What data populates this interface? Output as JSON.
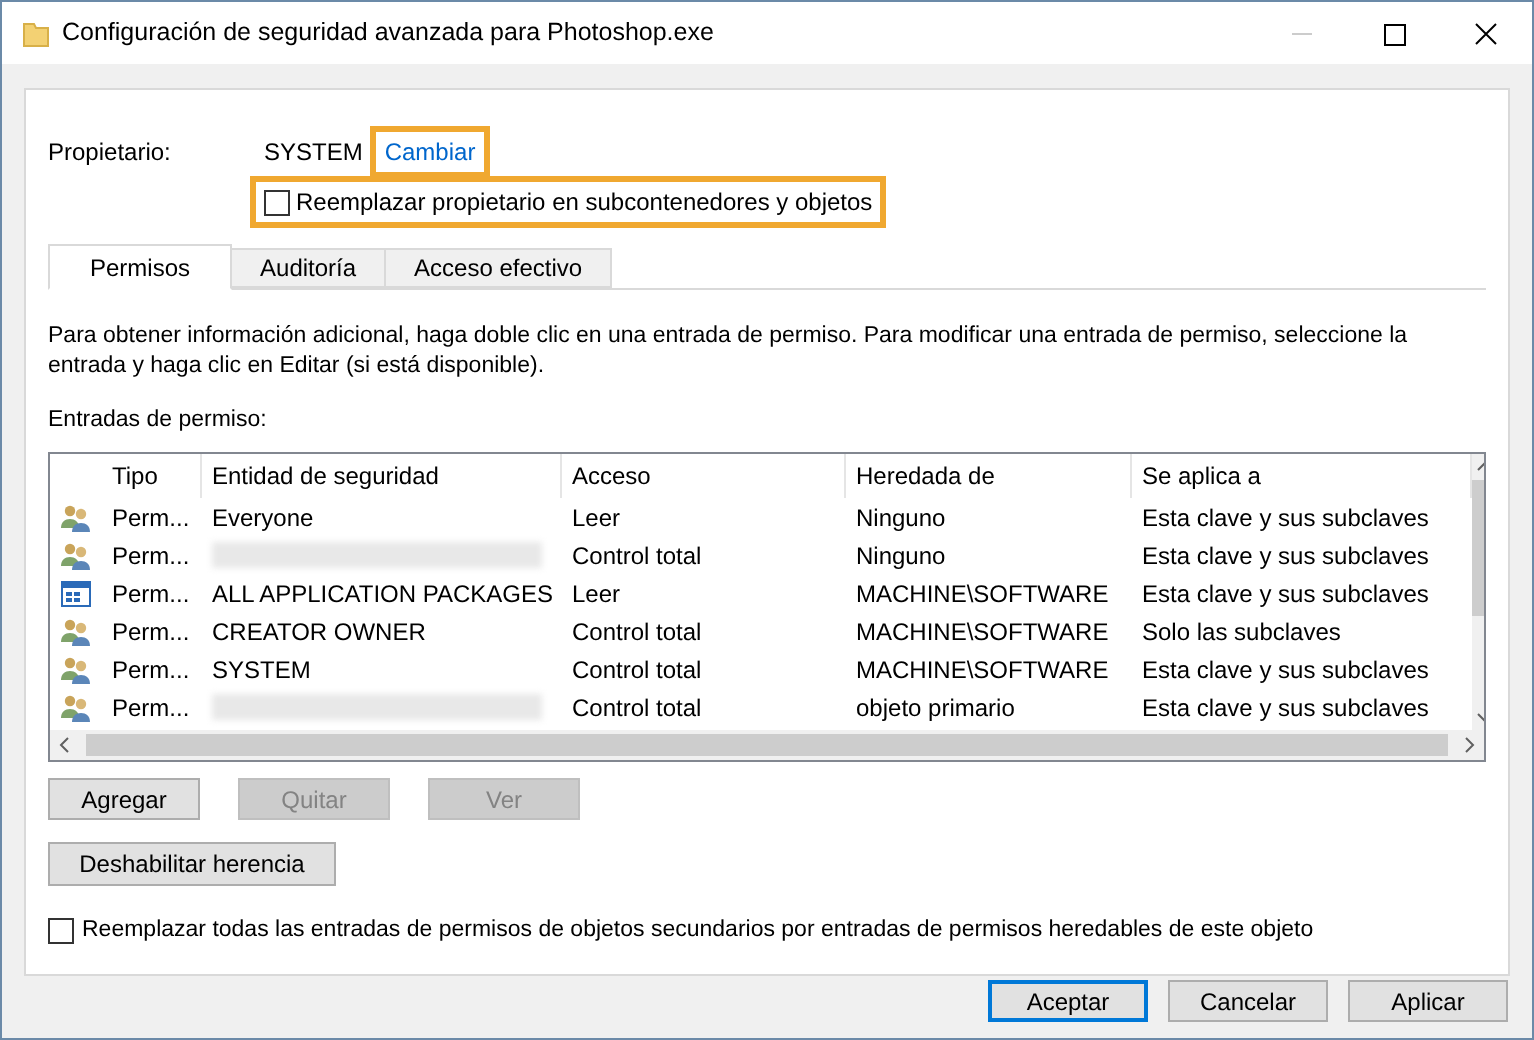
{
  "window": {
    "title": "Configuración de seguridad avanzada para Photoshop.exe"
  },
  "owner": {
    "label": "Propietario:",
    "value": "SYSTEM",
    "change_link": "Cambiar",
    "replace_checkbox": {
      "label": "Reemplazar propietario en subcontenedores y objetos",
      "checked": false
    }
  },
  "tabs": [
    {
      "label": "Permisos",
      "selected": true
    },
    {
      "label": "Auditoría",
      "selected": false
    },
    {
      "label": "Acceso efectivo",
      "selected": false
    }
  ],
  "info_text": "Para obtener información adicional, haga doble clic en una entrada de permiso. Para modificar una entrada de permiso, seleccione la entrada y haga clic en Editar (si está disponible).",
  "entries_label": "Entradas de permiso:",
  "table": {
    "columns": [
      "Tipo",
      "Entidad de seguridad",
      "Acceso",
      "Heredada de",
      "Se aplica a"
    ],
    "rows": [
      {
        "kind": "group",
        "type": "Perm...",
        "principal": "Everyone",
        "access": "Leer",
        "inherited_from": "Ninguno",
        "applies_to": "Esta clave y sus subclaves"
      },
      {
        "kind": "group",
        "type": "Perm...",
        "principal_redacted": true,
        "access": "Control total",
        "inherited_from": "Ninguno",
        "applies_to": "Esta clave y sus subclaves"
      },
      {
        "kind": "package",
        "type": "Perm...",
        "principal": "ALL APPLICATION PACKAGES",
        "access": "Leer",
        "inherited_from": "MACHINE\\SOFTWARE",
        "applies_to": "Esta clave y sus subclaves"
      },
      {
        "kind": "group",
        "type": "Perm...",
        "principal": "CREATOR OWNER",
        "access": "Control total",
        "inherited_from": "MACHINE\\SOFTWARE",
        "applies_to": "Solo las subclaves"
      },
      {
        "kind": "group",
        "type": "Perm...",
        "principal": "SYSTEM",
        "access": "Control total",
        "inherited_from": "MACHINE\\SOFTWARE",
        "applies_to": "Esta clave y sus subclaves"
      },
      {
        "kind": "group",
        "type": "Perm...",
        "principal_redacted": true,
        "access": "Control total",
        "inherited_from": "objeto primario",
        "applies_to": "Esta clave y sus subclaves"
      }
    ]
  },
  "entry_buttons": [
    {
      "label": "Agregar",
      "disabled": false
    },
    {
      "label": "Quitar",
      "disabled": true
    },
    {
      "label": "Ver",
      "disabled": true
    }
  ],
  "disable_inheritance_button": "Deshabilitar herencia",
  "replace_child_checkbox": {
    "label": "Reemplazar todas las entradas de permisos de objetos secundarios por entradas de permisos heredables de este objeto",
    "checked": false
  },
  "dialog_buttons": [
    {
      "label": "Aceptar",
      "default": true
    },
    {
      "label": "Cancelar",
      "default": false
    },
    {
      "label": "Aplicar",
      "default": false
    }
  ]
}
